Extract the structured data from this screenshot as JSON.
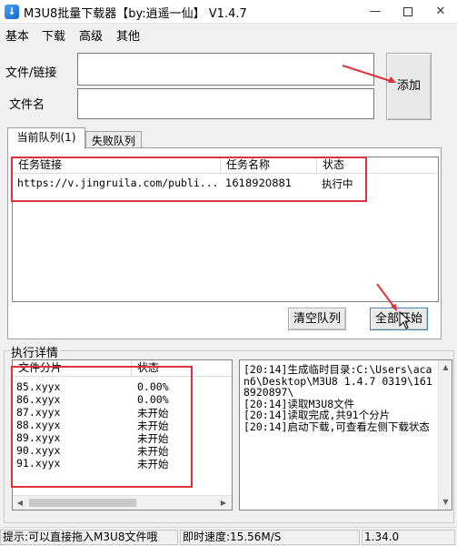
{
  "window": {
    "title": "M3U8批量下载器【by:逍遥一仙】  V1.4.7",
    "minimize": "—",
    "close": "✕"
  },
  "menu": [
    "基本",
    "下载",
    "高级",
    "其他"
  ],
  "form": {
    "file_link_label": "文件/链接",
    "file_link_value": "",
    "file_name_label": "文件名",
    "file_name_value": "",
    "add_button": "添加"
  },
  "tabs": [
    {
      "label": "当前队列(1)",
      "active": true
    },
    {
      "label": "失败队列",
      "active": false
    }
  ],
  "queue": {
    "columns": [
      "任务链接",
      "任务名称",
      "状态"
    ],
    "rows": [
      {
        "link": "https://v.jingruila.com/publi...",
        "name": "1618920881",
        "status": "执行中"
      }
    ],
    "clear_button": "清空队列",
    "start_all_button": "全部开始"
  },
  "details": {
    "group_title": "执行详情",
    "columns": [
      "文件分片",
      "状态"
    ],
    "rows": [
      {
        "file": "85.xyyx",
        "status": "0.00%"
      },
      {
        "file": "86.xyyx",
        "status": "0.00%"
      },
      {
        "file": "87.xyyx",
        "status": "未开始"
      },
      {
        "file": "88.xyyx",
        "status": "未开始"
      },
      {
        "file": "89.xyyx",
        "status": "未开始"
      },
      {
        "file": "90.xyyx",
        "status": "未开始"
      },
      {
        "file": "91.xyyx",
        "status": "未开始"
      }
    ],
    "log": "[20:14]生成临时目录:C:\\Users\\acan6\\Desktop\\M3U8 1.4.7 0319\\1618920897\\\n[20:14]读取M3U8文件\n[20:14]读取完成,共91个分片\n[20:14]启动下载,可查看左侧下载状态"
  },
  "status_bar": {
    "hint": "提示:可以直接拖入M3U8文件哦",
    "speed": "即时速度:15.56M/S",
    "version": "1.34.0"
  },
  "colors": {
    "annotation": "#e0303a",
    "background": "#f0f0f0"
  }
}
